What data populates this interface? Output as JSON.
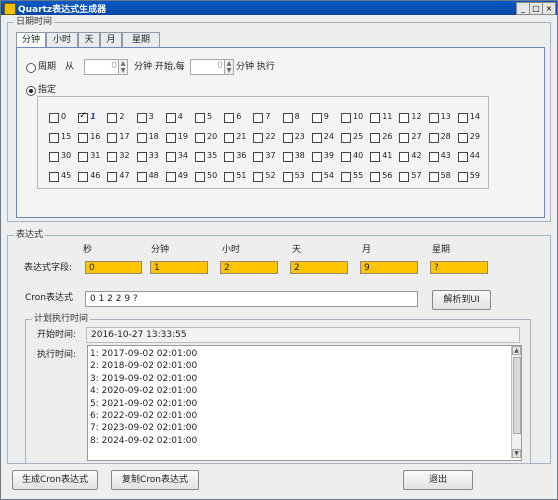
{
  "window": {
    "title": "Quartz表达式生成器",
    "controls": {
      "minimize": "_",
      "maximize": "□",
      "close": "×"
    }
  },
  "date_group": {
    "title": "日期时间",
    "tabs": [
      "分钟",
      "小时",
      "天",
      "月",
      "星期"
    ],
    "active_tab": "分钟",
    "period": {
      "label": "周期",
      "from_label": "从",
      "from_value": "0",
      "start_label": "分钟 开始,每",
      "every_value": "0",
      "exec_label": "分钟 执行"
    },
    "specify": {
      "label": "指定",
      "checked_values": [
        "1"
      ],
      "minutes": [
        [
          "0",
          "1",
          "2",
          "3",
          "4",
          "5",
          "6",
          "7",
          "8",
          "9",
          "10",
          "11",
          "12",
          "13",
          "14"
        ],
        [
          "15",
          "16",
          "17",
          "18",
          "19",
          "20",
          "21",
          "22",
          "23",
          "24",
          "25",
          "26",
          "27",
          "28",
          "29"
        ],
        [
          "30",
          "31",
          "32",
          "33",
          "34",
          "35",
          "36",
          "37",
          "38",
          "39",
          "40",
          "41",
          "42",
          "43",
          "44"
        ],
        [
          "45",
          "46",
          "47",
          "48",
          "49",
          "50",
          "51",
          "52",
          "53",
          "54",
          "55",
          "56",
          "57",
          "58",
          "59"
        ]
      ]
    }
  },
  "expression_group": {
    "title": "表达式",
    "field_label": "表达式字段:",
    "columns": [
      "秒",
      "分钟",
      "小时",
      "天",
      "月",
      "星期"
    ],
    "values": [
      "0",
      "1",
      "2",
      "2",
      "9",
      "?"
    ],
    "cron_label": "Cron表达式",
    "cron_value": "0 1 2 2 9 ?",
    "parse_button": "解析到UI"
  },
  "schedule_group": {
    "title": "计划执行时间",
    "start_label": "开始时间:",
    "start_value": "2016-10-27 13:33:55",
    "exec_label": "执行时间:",
    "exec_times": [
      "1: 2017-09-02 02:01:00",
      "2: 2018-09-02 02:01:00",
      "3: 2019-09-02 02:01:00",
      "4: 2020-09-02 02:01:00",
      "5: 2021-09-02 02:01:00",
      "6: 2022-09-02 02:01:00",
      "7: 2023-09-02 02:01:00",
      "8: 2024-09-02 02:01:00"
    ]
  },
  "buttons": {
    "generate": "生成Cron表达式",
    "copy": "复制Cron表达式",
    "exit": "退出"
  },
  "colors": {
    "title_bar": "#0745a6",
    "field_fill": "#ffc400",
    "checked_label": "#1a3fb0"
  }
}
